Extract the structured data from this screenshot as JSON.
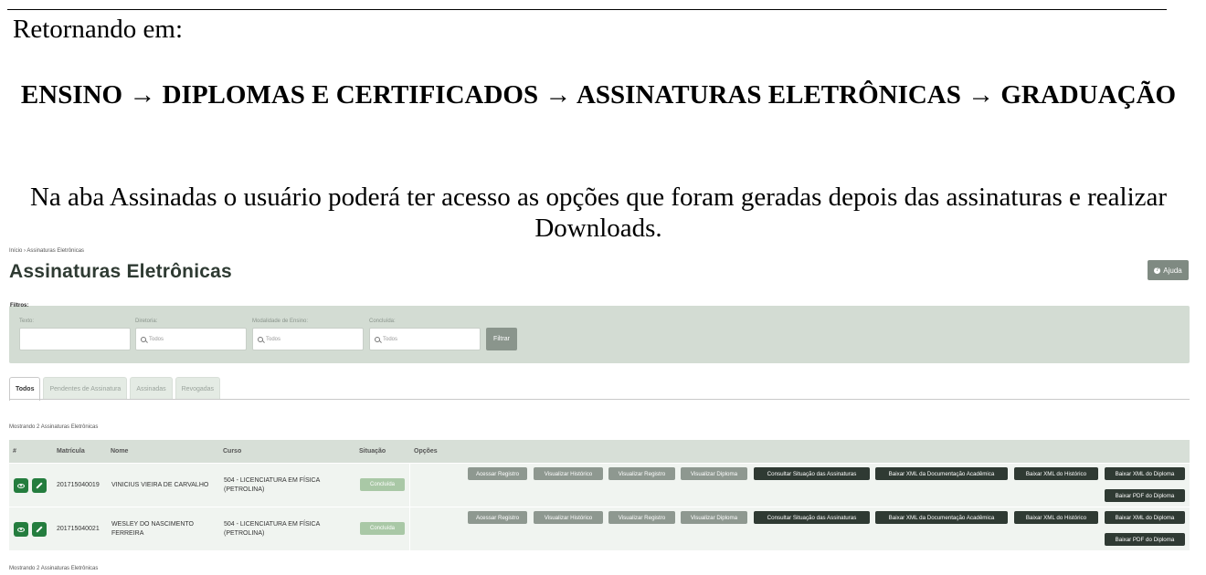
{
  "document": {
    "intro": "Retornando em:",
    "path": "ENSINO → DIPLOMAS E CERTIFICADOS → ASSINATURAS ELETRÔNICAS → GRADUAÇÃO",
    "description": "Na aba Assinadas o usuário poderá ter acesso as opções que foram geradas depois das assinaturas e realizar Downloads."
  },
  "app": {
    "breadcrumb": "Início › Assinaturas Eletrônicas",
    "title": "Assinaturas Eletrônicas",
    "help_label": "Ajuda",
    "help_icon": "question-circle-icon",
    "filters": {
      "title": "Filtros:",
      "texto_label": "Texto:",
      "texto_value": "",
      "diretoria_label": "Diretoria:",
      "diretoria_placeholder": "Todos",
      "modalidade_label": "Modalidade de Ensino:",
      "modalidade_placeholder": "Todos",
      "concluida_label": "Concluída:",
      "concluida_placeholder": "Todos",
      "filter_button": "Filtrar"
    },
    "tabs": [
      "Todos",
      "Pendentes de Assinatura",
      "Assinadas",
      "Revogadas"
    ],
    "active_tab": "Todos",
    "count_text": "Mostrando 2 Assinaturas Eletrônicas",
    "columns": [
      "#",
      "Matrícula",
      "Nome",
      "Curso",
      "Situação",
      "Opções"
    ],
    "rows": [
      {
        "matricula": "201715040019",
        "nome": "VINICIUS VIEIRA DE CARVALHO",
        "nome2": "",
        "curso": "504 - LICENCIATURA EM FÍSICA",
        "curso2": "(PETROLINA)",
        "situacao": "Concluída"
      },
      {
        "matricula": "201715040021",
        "nome": "WESLEY DO NASCIMENTO",
        "nome2": "FERREIRA",
        "curso": "504 - LICENCIATURA EM FÍSICA",
        "curso2": "(PETROLINA)",
        "situacao": "Concluída"
      }
    ],
    "actions": {
      "acessar_registro": "Acessar Registro",
      "visualizar_historico": "Visualizar Histórico",
      "visualizar_registro": "Visualizar Registro",
      "visualizar_diploma": "Visualizar Diploma",
      "consultar_situacao": "Consultar Situação das Assinaturas",
      "baixar_xml_doc": "Baixar XML da Documentação Acadêmica",
      "baixar_xml_historico": "Baixar XML do Histórico",
      "baixar_xml_diploma": "Baixar XML do Diploma",
      "baixar_pdf_diploma": "Baixar PDF do Diploma"
    },
    "colors": {
      "accent": "#247d3e",
      "filters_bg": "#d3dcd3",
      "badge": "#a9c8a6",
      "dark_btn": "#2f3a33",
      "light_btn": "#8e9890"
    }
  }
}
